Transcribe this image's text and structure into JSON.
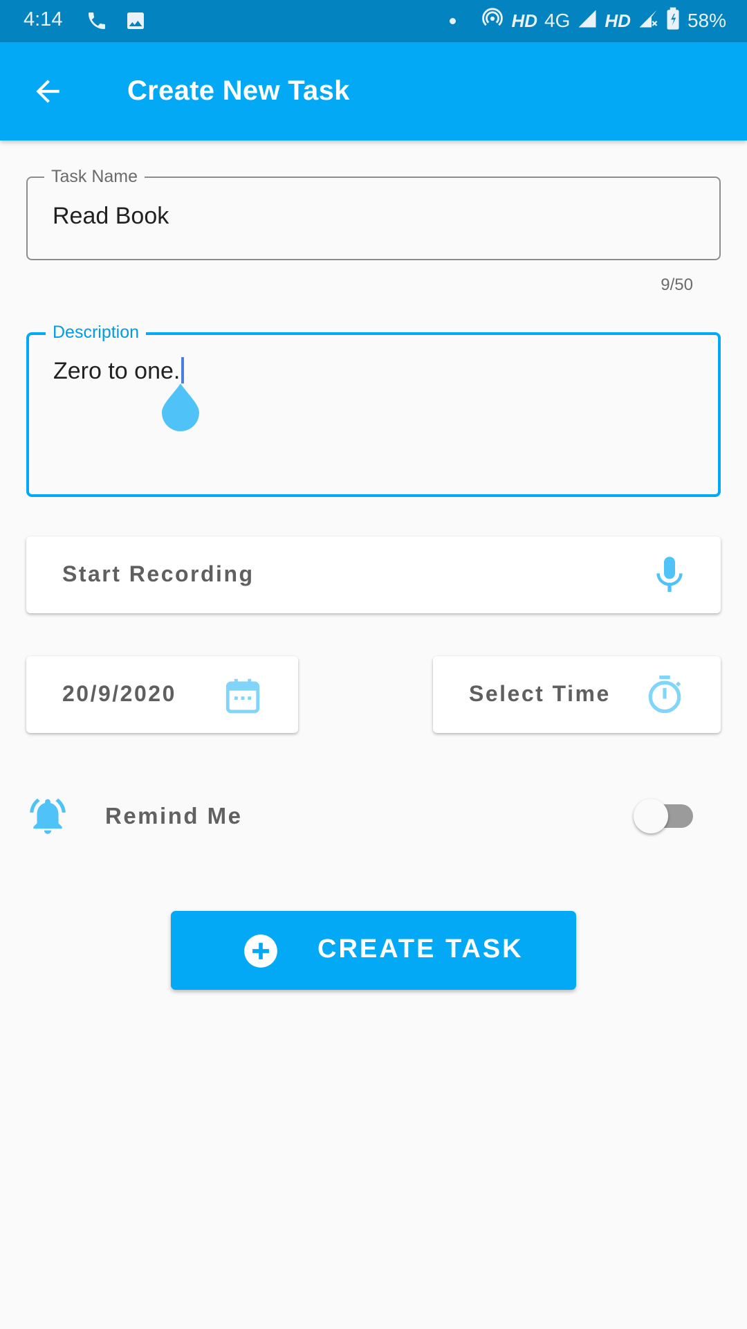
{
  "status_bar": {
    "time": "4:14",
    "network_labels": [
      "HD",
      "4G",
      "HD"
    ],
    "battery": "58%"
  },
  "app_bar": {
    "title": "Create New Task"
  },
  "form": {
    "task_name": {
      "label": "Task Name",
      "value": "Read Book",
      "counter": "9/50"
    },
    "description": {
      "label": "Description",
      "value": "Zero to one."
    },
    "recording": {
      "label": "Start Recording",
      "icon": "mic-icon"
    },
    "date": {
      "value": "20/9/2020",
      "icon": "calendar-icon"
    },
    "time": {
      "label": "Select Time",
      "icon": "timer-icon"
    },
    "reminder": {
      "label": "Remind Me",
      "enabled": false,
      "icon": "bell-icon"
    },
    "create_button": {
      "label": "CREATE TASK",
      "icon": "add-circle-icon"
    }
  },
  "colors": {
    "primary": "#03a9f4",
    "status_bar": "#0383bf",
    "icon_light": "#4fc3f7",
    "background": "#fafafa"
  }
}
